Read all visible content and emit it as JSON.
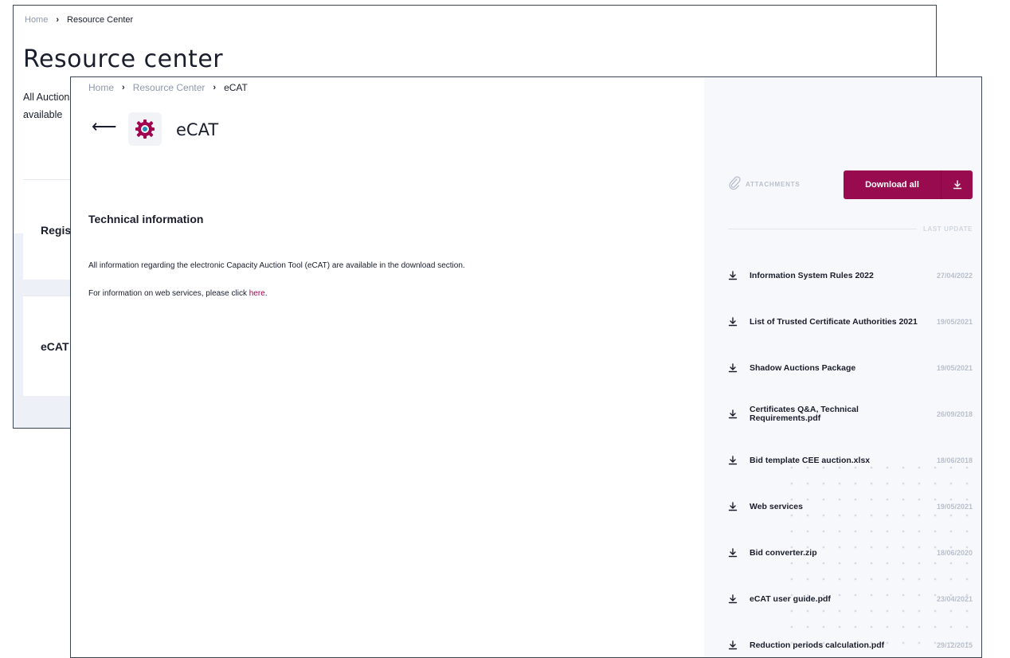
{
  "back_window": {
    "breadcrumb": {
      "home": "Home",
      "current": "Resource Center"
    },
    "title": "Resource center",
    "description_lines": [
      "All Auctions",
      "available"
    ],
    "cards": [
      "Registration",
      "eCAT"
    ]
  },
  "front_window": {
    "breadcrumb": {
      "home": "Home",
      "parent": "Resource Center",
      "current": "eCAT"
    },
    "app_title": "eCAT",
    "section_title": "Technical information",
    "paragraph1": "All information regarding the electronic Capacity Auction Tool (eCAT) are available in the download section.",
    "paragraph2_prefix": "For information on web services, please click ",
    "paragraph2_link": "here",
    "paragraph2_suffix": ".",
    "attachments": {
      "label": "ATTACHMENTS",
      "download_all_label": "Download all",
      "last_update_label": "LAST UPDATE",
      "files": [
        {
          "name": "Information System Rules 2022",
          "date": "27/04/2022"
        },
        {
          "name": "List of Trusted Certificate Authorities 2021",
          "date": "19/05/2021"
        },
        {
          "name": "Shadow Auctions Package",
          "date": "19/05/2021"
        },
        {
          "name": "Certificates Q&A, Technical Requirements.pdf",
          "date": "26/09/2018"
        },
        {
          "name": "Bid template CEE auction.xlsx",
          "date": "18/06/2018"
        },
        {
          "name": "Web services",
          "date": "19/05/2021"
        },
        {
          "name": "Bid converter.zip",
          "date": "18/06/2020"
        },
        {
          "name": "eCAT user guide.pdf",
          "date": "23/04/2021"
        },
        {
          "name": "Reduction periods calculation.pdf",
          "date": "29/12/2015"
        }
      ]
    },
    "colors": {
      "accent": "#980c4f",
      "link": "#a1004f",
      "panel_bg": "#f7f8fb"
    }
  }
}
